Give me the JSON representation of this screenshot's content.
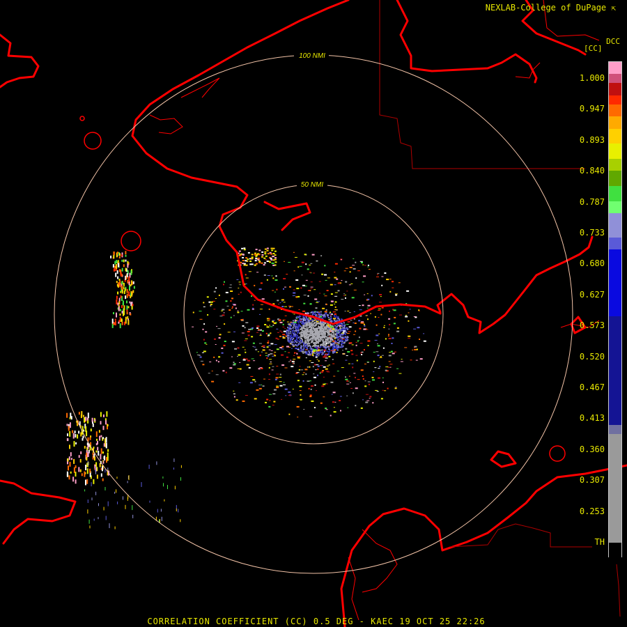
{
  "header": {
    "credit": "NEXLAB-College of DuPage",
    "corner_icon": "corner-arrow-icon"
  },
  "legend": {
    "product_code": "DCC",
    "unit": "[CC]",
    "labels": [
      "1.000",
      "0.947",
      "0.893",
      "0.840",
      "0.787",
      "0.733",
      "0.680",
      "0.627",
      "0.573",
      "0.520",
      "0.467",
      "0.413",
      "0.360",
      "0.307",
      "0.253",
      "TH"
    ],
    "colors": [
      {
        "from": 1.02,
        "to": 1.0,
        "color": "#ff9ec8"
      },
      {
        "from": 1.0,
        "to": 0.985,
        "color": "#d0507a"
      },
      {
        "from": 0.985,
        "to": 0.965,
        "color": "#c01010"
      },
      {
        "from": 0.965,
        "to": 0.95,
        "color": "#ff2a00"
      },
      {
        "from": 0.95,
        "to": 0.93,
        "color": "#ff6a00"
      },
      {
        "from": 0.93,
        "to": 0.91,
        "color": "#ffaa00"
      },
      {
        "from": 0.91,
        "to": 0.885,
        "color": "#ffd000"
      },
      {
        "from": 0.885,
        "to": 0.86,
        "color": "#e8f000"
      },
      {
        "from": 0.86,
        "to": 0.84,
        "color": "#a8d000"
      },
      {
        "from": 0.84,
        "to": 0.815,
        "color": "#60a800"
      },
      {
        "from": 0.815,
        "to": 0.79,
        "color": "#40e040"
      },
      {
        "from": 0.79,
        "to": 0.77,
        "color": "#70ff70"
      },
      {
        "from": 0.77,
        "to": 0.73,
        "color": "#9090d8"
      },
      {
        "from": 0.73,
        "to": 0.71,
        "color": "#5a5ad8"
      },
      {
        "from": 0.71,
        "to": 0.6,
        "color": "#0a0ae0"
      },
      {
        "from": 0.6,
        "to": 0.42,
        "color": "#141494"
      },
      {
        "from": 0.42,
        "to": 0.405,
        "color": "#7070a0"
      },
      {
        "from": 0.405,
        "to": 0.225,
        "color": "#9a9a9a"
      },
      {
        "from": 0.225,
        "to": 0.2,
        "color": "#000000"
      }
    ]
  },
  "map": {
    "range_rings": [
      {
        "label": "100 NMI",
        "radius_nmi": 100
      },
      {
        "label": "50 NMI",
        "radius_nmi": 50
      }
    ]
  },
  "footer": {
    "title": "CORRELATION COEFFICIENT (CC) 0.5 DEG - KAEC 19 OCT 25 22:26"
  }
}
